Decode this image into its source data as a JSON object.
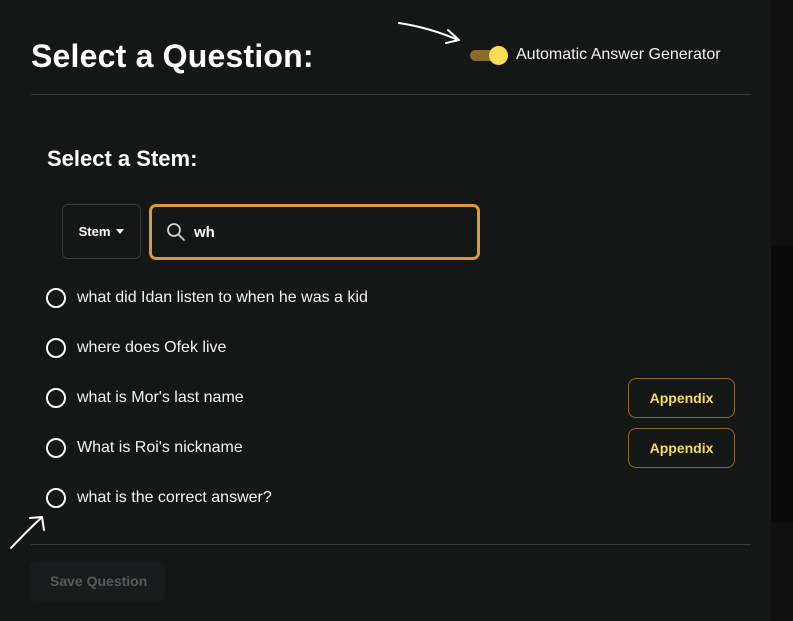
{
  "header": {
    "title": "Select a Question:",
    "toggle": {
      "label": "Automatic Answer Generator",
      "state": "on"
    }
  },
  "stem_section": {
    "title": "Select a Stem:",
    "filter_select": {
      "selected": "Stem"
    },
    "search": {
      "value": "wh",
      "icon": "search-icon"
    }
  },
  "questions": [
    {
      "text": "what did Idan listen to when he was a kid",
      "appendix": ""
    },
    {
      "text": "where does Ofek live",
      "appendix": ""
    },
    {
      "text": "what is Mor's last name",
      "appendix": "Appendix"
    },
    {
      "text": "What is Roi's nickname",
      "appendix": "Appendix"
    },
    {
      "text": "what is the correct answer?",
      "appendix": ""
    }
  ],
  "footer": {
    "save_label": "Save Question"
  },
  "colors": {
    "accent": "#e0992f",
    "toggle_thumb": "#f4df59",
    "background": "#151616"
  }
}
